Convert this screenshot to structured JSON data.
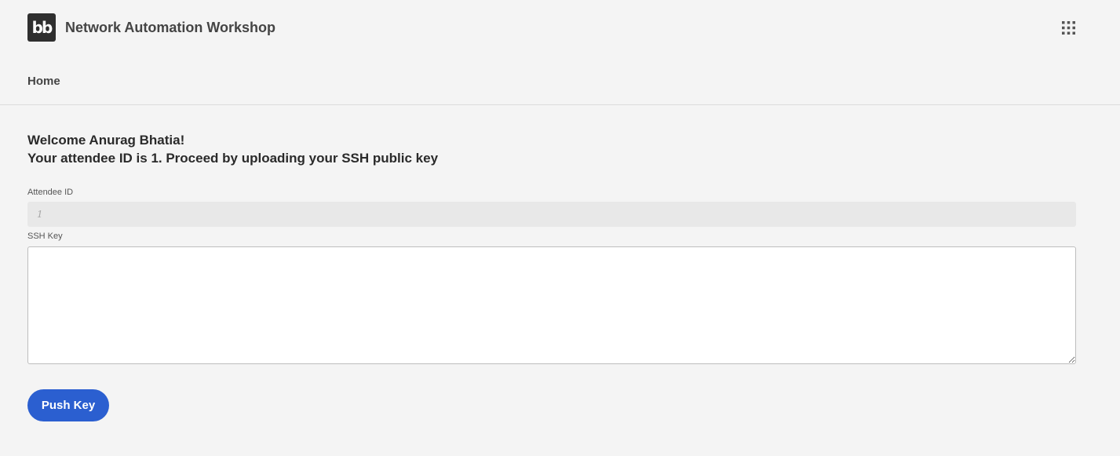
{
  "header": {
    "logo_text": "bb",
    "app_title": "Network Automation Workshop",
    "apps_icon": "grid-icon"
  },
  "nav": {
    "home_label": "Home"
  },
  "main": {
    "welcome_line1": "Welcome Anurag Bhatia!",
    "welcome_line2": "Your attendee ID is 1. Proceed by uploading your SSH public key",
    "attendee_id_label": "Attendee ID",
    "attendee_id_placeholder": "1",
    "ssh_key_label": "SSH Key",
    "ssh_key_value": "",
    "push_button_label": "Push Key"
  },
  "colors": {
    "background": "#f4f4f4",
    "accent": "#2b5fd0",
    "logo_bg": "#2f2f2f"
  }
}
